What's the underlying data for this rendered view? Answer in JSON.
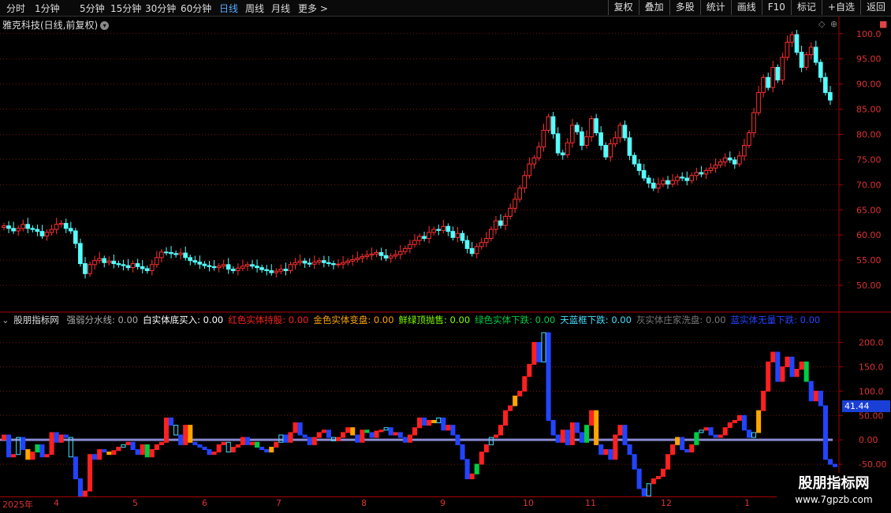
{
  "toolbar": {
    "periods": [
      "分时",
      "1分钟",
      "5分钟",
      "15分钟",
      "30分钟",
      "60分钟",
      "日线",
      "周线",
      "月线",
      "更多"
    ],
    "active_period": "日线",
    "right_buttons": [
      "复权",
      "叠加",
      "多股",
      "统计",
      "画线",
      "F10",
      "标记",
      "+自选",
      "返回"
    ]
  },
  "stock": {
    "title": "雅克科技(日线,前复权)"
  },
  "price_axis": {
    "ticks": [
      "100.0",
      "95.00",
      "90.00",
      "85.00",
      "80.00",
      "75.00",
      "70.00",
      "65.00",
      "60.00",
      "55.00",
      "50.00"
    ]
  },
  "indicator": {
    "name": "股朋指标网",
    "items": [
      {
        "label": "强弱分水线: 0.00",
        "color": "#aaaaaa"
      },
      {
        "label": "白实体底买入: 0.00",
        "color": "#ffffff"
      },
      {
        "label": "红色实体持股: 0.00",
        "color": "#ff2020"
      },
      {
        "label": "金色实体变盘: 0.00",
        "color": "#ffa500"
      },
      {
        "label": "鲜绿顶抛售: 0.00",
        "color": "#80ff00"
      },
      {
        "label": "绿色实体下跌: 0.00",
        "color": "#00cc44"
      },
      {
        "label": "天蓝框下跌: 0.00",
        "color": "#44e0ff"
      },
      {
        "label": "灰实体庄家洗盘: 0.00",
        "color": "#777777"
      },
      {
        "label": "蓝实体无量下跌: 0.00",
        "color": "#2244ff"
      }
    ],
    "ticks": [
      "200.0",
      "150.0",
      "100.0",
      "50.00",
      "0.00",
      "-50.00"
    ],
    "current_value": "41.44"
  },
  "time_axis": {
    "labels": [
      "2025年",
      "4",
      "5",
      "6",
      "7",
      "8",
      "9",
      "10",
      "11",
      "12",
      "1"
    ]
  },
  "watermark": {
    "name": "股朋指标网",
    "url": "www.7gpzb.com"
  },
  "colors": {
    "up": "#ff3030",
    "down": "#54ffff",
    "grid": "#7a1010",
    "bg": "#000000"
  },
  "chart_data": {
    "type": "candlestick",
    "ylim": [
      45,
      102
    ],
    "closes": [
      61.5,
      61,
      60.5,
      61,
      61.8,
      61,
      60.8,
      60.4,
      59.5,
      60.2,
      60.8,
      61.8,
      62,
      61,
      60.5,
      58,
      54,
      52,
      53.8,
      54.6,
      55,
      54.2,
      54.5,
      54,
      53.8,
      53.6,
      53.2,
      54,
      53.4,
      53,
      52.6,
      53.8,
      55.2,
      56.3,
      56.2,
      56,
      55.8,
      56.1,
      55.2,
      54.6,
      54.3,
      53.9,
      53.6,
      53.4,
      53.2,
      53.5,
      53.8,
      52.9,
      52.6,
      53.1,
      53.5,
      53.8,
      53.5,
      53.2,
      52.8,
      52.6,
      52.2,
      52.5,
      52.9,
      52.6,
      53.8,
      54.2,
      54.5,
      54.1,
      53.9,
      54.3,
      54.6,
      54.2,
      54.0,
      53.8,
      53.9,
      54.2,
      54.5,
      54.8,
      55.1,
      55.4,
      55.7,
      55.9,
      56.2,
      55.6,
      55.1,
      55.5,
      55.8,
      56.4,
      57.0,
      57.8,
      58.6,
      59.4,
      59.0,
      60.2,
      60.8,
      60.6,
      61.4,
      60.4,
      59.2,
      60.0,
      58.6,
      57.0,
      56.0,
      57.4,
      58.2,
      59.0,
      60.8,
      62.5,
      61.6,
      63.4,
      65.0,
      66.8,
      69.0,
      71.5,
      73.8,
      75.0,
      77.2,
      80.5,
      83.2,
      79.8,
      76.0,
      75.6,
      78.0,
      81.5,
      80.2,
      77.5,
      79.2,
      82.8,
      80.0,
      77.5,
      75.2,
      77.8,
      79.0,
      81.5,
      79.0,
      75.5,
      73.8,
      72.5,
      71.0,
      70.0,
      69.0,
      69.8,
      70.5,
      69.8,
      70.5,
      71.2,
      71.0,
      70.5,
      71.5,
      72.1,
      71.8,
      72.5,
      73.0,
      73.6,
      74.2,
      75.0,
      74.6,
      73.8,
      75.4,
      77.5,
      80.0,
      84.0,
      88.0,
      91.0,
      89.0,
      93.0,
      90.5,
      95.0,
      98.0,
      99.5,
      96.0,
      93.0,
      95.5,
      97.0,
      94.0,
      91.0,
      88.0,
      86.5
    ],
    "x_labels": [
      "2025年",
      "4",
      "5",
      "6",
      "7",
      "8",
      "9",
      "10",
      "11",
      "12",
      "1"
    ],
    "indicator_series": {
      "name": "强弱分水线",
      "ylim": [
        -100,
        230
      ],
      "values": [
        10,
        -35,
        -30,
        5,
        -20,
        -40,
        -25,
        -10,
        -35,
        -30,
        15,
        -5,
        10,
        5,
        -35,
        -80,
        -120,
        -105,
        -30,
        -40,
        -20,
        -25,
        -30,
        -22,
        -15,
        -10,
        -5,
        -20,
        -30,
        -10,
        -35,
        -20,
        -10,
        -5,
        45,
        30,
        10,
        -10,
        30,
        -5,
        -10,
        -15,
        -20,
        -30,
        -25,
        -10,
        -5,
        -25,
        -15,
        -10,
        5,
        -10,
        -5,
        -15,
        -20,
        -25,
        -15,
        -5,
        10,
        -5,
        15,
        35,
        10,
        5,
        -10,
        5,
        15,
        20,
        5,
        -2,
        5,
        15,
        25,
        10,
        -5,
        20,
        15,
        5,
        18,
        20,
        25,
        10,
        15,
        5,
        -5,
        10,
        25,
        45,
        30,
        40,
        35,
        45,
        20,
        30,
        10,
        -10,
        -40,
        -80,
        -70,
        -50,
        -25,
        -10,
        5,
        10,
        30,
        60,
        70,
        90,
        100,
        130,
        155,
        200,
        160,
        220,
        40,
        10,
        -5,
        20,
        -10,
        35,
        15,
        -5,
        30,
        60,
        -10,
        -30,
        -20,
        -40,
        10,
        30,
        -10,
        -30,
        -60,
        -100,
        -115,
        -90,
        -80,
        -75,
        -60,
        -30,
        -10,
        5,
        -20,
        -25,
        -10,
        15,
        20,
        25,
        10,
        5,
        10,
        25,
        35,
        40,
        50,
        20,
        5,
        15,
        60,
        100,
        160,
        180,
        120,
        150,
        170,
        130,
        145,
        160,
        120,
        80,
        100,
        70,
        -40,
        -50,
        -55
      ]
    }
  }
}
